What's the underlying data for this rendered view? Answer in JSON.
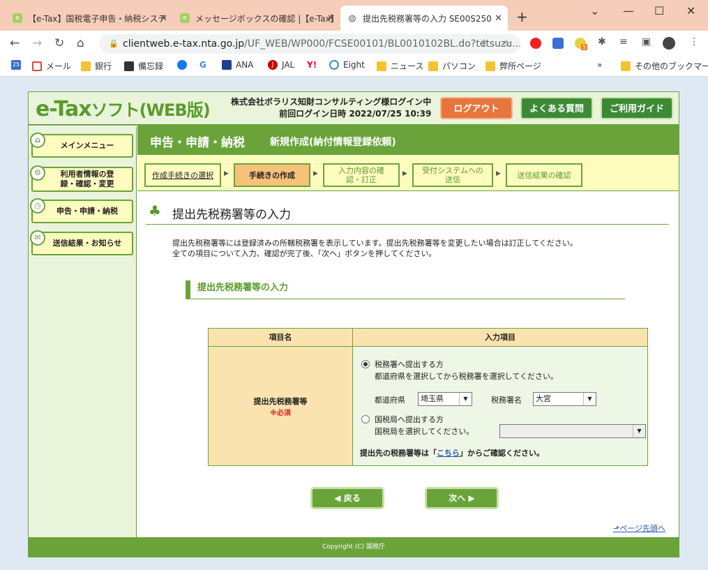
{
  "browser": {
    "tabs": [
      {
        "label": "【e-Tax】国税電子申告・納税システム"
      },
      {
        "label": "メッセージボックスの確認 |【e-Tax】国"
      },
      {
        "label": "提出先税務署等の入力 SE00S250"
      }
    ],
    "url_host": "clientweb.e-tax.nta.go.jp",
    "url_path": "/UF_WEB/WP000/FCSE00101/BL0010102BL.do?tetsuzu...",
    "extension_badge": "5",
    "bookmarks": [
      "メール",
      "銀行",
      "備忘録",
      "ANA",
      "JAL",
      "Eight",
      "ニュース",
      "パソコン",
      "弊所ページ"
    ],
    "other_bookmarks": "その他のブックマーク",
    "bookmark_overflow": "»",
    "google_letter": "G",
    "yahoo_letter": "Y!",
    "calendar_day": "25",
    "jal_letter": "J"
  },
  "header": {
    "logo_main": "e-Tax",
    "logo_sub": "ソフト(WEB版)",
    "login_line1": "株式会社ボラリス知財コンサルティング様ログイン中",
    "login_line2": "前回ログイン日時 2022/07/25 10:39",
    "logout": "ログアウト",
    "faq": "よくある質問",
    "guide": "ご利用ガイド"
  },
  "sidebar": {
    "items": [
      {
        "label": "メインメニュー"
      },
      {
        "label": "利用者情報の登録・確認・変更"
      },
      {
        "label": "申告・申請・納税"
      },
      {
        "label": "送信結果・お知らせ"
      }
    ]
  },
  "titlebar": {
    "section": "申告・申請・納税",
    "subtitle": "新規作成(納付情報登録依頼)"
  },
  "steps": [
    {
      "label": "作成手続きの選択"
    },
    {
      "label": "手続きの作成"
    },
    {
      "label": "入力内容の確認・訂正"
    },
    {
      "label": "受付システムへの送信"
    },
    {
      "label": "送信結果の確認"
    }
  ],
  "main": {
    "heading": "提出先税務署等の入力",
    "desc1": "提出先税務署等には登録済みの所轄税務署を表示しています。提出先税務署等を変更したい場合は訂正してください。",
    "desc2": "全ての項目について入力、確認が完了後、「次へ」ボタンを押してください。",
    "subheading": "提出先税務署等の入力",
    "table": {
      "col1": "項目名",
      "col2": "入力項目",
      "row_label": "提出先税務署等",
      "required": "※必須",
      "opt1": "税務署へ提出する方",
      "opt1_desc": "都道府県を選択してから税務署を選択してください。",
      "pref_label": "都道府県",
      "pref_value": "埼玉県",
      "office_label": "税務署名",
      "office_value": "大宮",
      "opt2": "国税局へ提出する方",
      "opt2_desc": "国税局を選択してください。",
      "bureau_value": "",
      "note_pre": "提出先の税務署等は「",
      "note_link": "こちら",
      "note_post": "」からご確認ください。"
    },
    "back": "戻る",
    "next": "次へ",
    "pagetop": "ページ先頭へ"
  },
  "footer": "Copyright (C) 国税庁"
}
